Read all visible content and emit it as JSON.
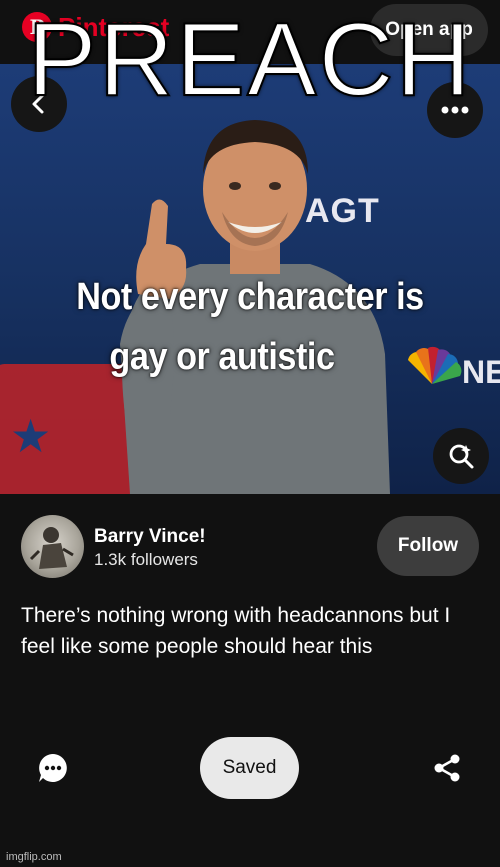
{
  "header": {
    "brand": "Pinterest",
    "open_app_label": "Open app"
  },
  "overlay_text": "PREACH",
  "pin": {
    "caption_line1": "Not every character is",
    "caption_line2": "gay or autistic",
    "backdrop_text": "AGT",
    "network_text": "NE"
  },
  "creator": {
    "name": "Barry Vince!",
    "followers": "1.3k followers",
    "follow_label": "Follow"
  },
  "description": "There’s nothing wrong with headcannons but I feel like some people should hear this",
  "actions": {
    "saved_label": "Saved"
  },
  "watermark": "imgflip.com",
  "colors": {
    "brand_red": "#e60023",
    "background": "#111111",
    "saved_bg": "#e9e9e9",
    "follow_bg": "#3d3d3d"
  }
}
